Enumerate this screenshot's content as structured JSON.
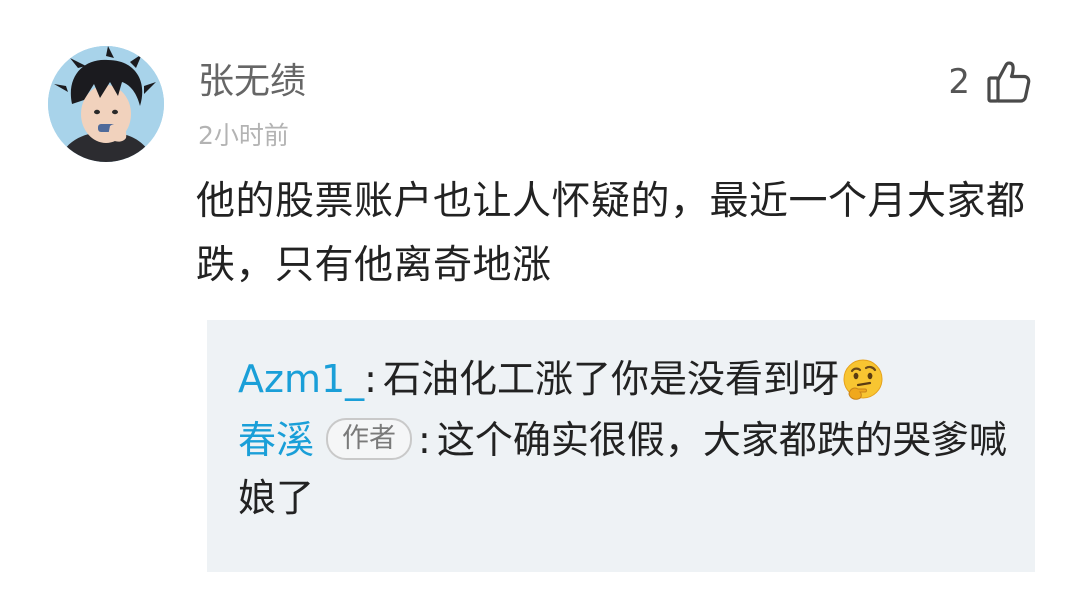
{
  "comment": {
    "username": "张无绩",
    "time": "2小时前",
    "like_count": "2",
    "text": "他的股票账户也让人怀疑的，最近一个月大家都跌，只有他离奇地涨"
  },
  "replies": [
    {
      "author": "Azm1_",
      "colon": ":",
      "text": "石油化工涨了你是没看到呀",
      "emoji": "thinking-face-emoji"
    },
    {
      "author": "春溪",
      "badge": "作者",
      "colon": ":",
      "text": "这个确实很假，大家都跌的哭爹喊娘了"
    }
  ],
  "colors": {
    "reply_author": "#1a9fd8",
    "reply_background": "#eef2f5"
  }
}
